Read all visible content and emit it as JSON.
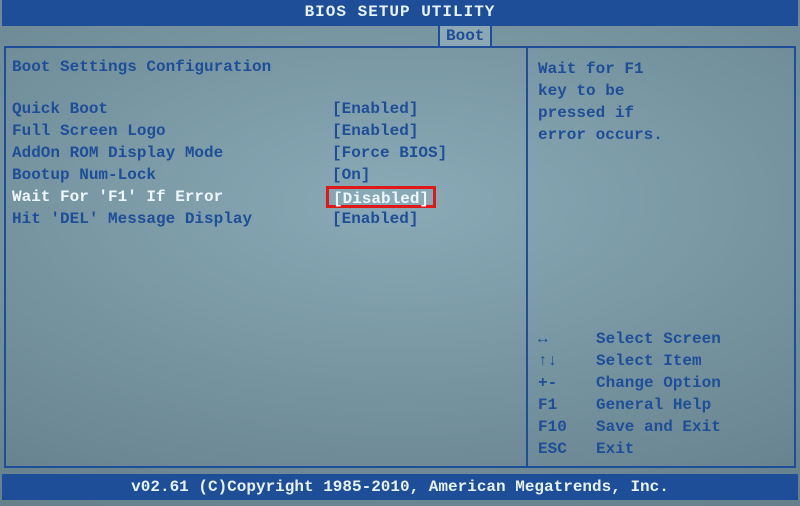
{
  "title": "BIOS SETUP UTILITY",
  "active_tab": "Boot",
  "section_title": "Boot Settings Configuration",
  "settings": [
    {
      "label": "Quick Boot",
      "value": "[Enabled]",
      "selected": false
    },
    {
      "label": "Full Screen Logo",
      "value": "[Enabled]",
      "selected": false
    },
    {
      "label": "AddOn ROM Display Mode",
      "value": "[Force BIOS]",
      "selected": false
    },
    {
      "label": "Bootup Num-Lock",
      "value": "[On]",
      "selected": false
    },
    {
      "label": "Wait For 'F1' If Error",
      "value": "[Disabled]",
      "selected": true
    },
    {
      "label": "Hit 'DEL' Message Display",
      "value": "[Enabled]",
      "selected": false
    }
  ],
  "help_text": "Wait for F1\nkey to be\npressed if\nerror occurs.",
  "key_hints": [
    {
      "key": "↔",
      "action": "Select Screen"
    },
    {
      "key": "↑↓",
      "action": "Select Item"
    },
    {
      "key": "+-",
      "action": "Change Option"
    },
    {
      "key": "F1",
      "action": "General Help"
    },
    {
      "key": "F10",
      "action": "Save and Exit"
    },
    {
      "key": "ESC",
      "action": "Exit"
    }
  ],
  "footer": "v02.61 (C)Copyright 1985-2010, American Megatrends, Inc."
}
